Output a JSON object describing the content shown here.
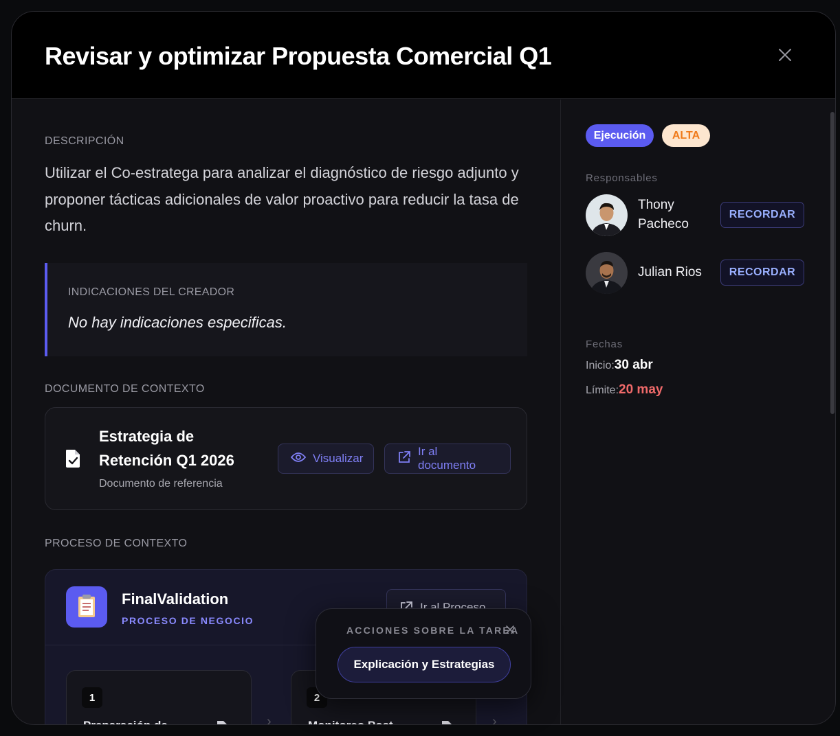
{
  "modal": {
    "title": "Revisar y optimizar Propuesta Comercial Q1"
  },
  "description": {
    "label": "DESCRIPCIÓN",
    "text": "Utilizar el Co-estratega para analizar el diagnóstico de riesgo adjunto y proponer tácticas adicionales de valor proactivo para reducir la tasa de churn."
  },
  "indications": {
    "label": "INDICACIONES DEL CREADOR",
    "text": "No hay indicaciones especificas."
  },
  "document": {
    "label": "DOCUMENTO DE CONTEXTO",
    "title": "Estrategia de Retención Q1 2026",
    "subtitle": "Documento de referencia",
    "view_label": "Visualizar",
    "open_label": "Ir al documento"
  },
  "process": {
    "label": "PROCESO DE CONTEXTO",
    "name": "FinalValidation",
    "kind": "PROCESO DE NEGOCIO",
    "open_label": "Ir al Proceso",
    "steps": [
      {
        "num": "1",
        "title": "Preparación de"
      },
      {
        "num": "2",
        "title": "Monitoreo Post"
      }
    ]
  },
  "popup": {
    "title": "ACCIONES SOBRE LA TAREA",
    "action_label": "Explicación y Estrategias"
  },
  "sidebar": {
    "stage_badge": "Ejecución",
    "priority_badge": "ALTA",
    "responsables_label": "Responsables",
    "people": [
      {
        "name": "Thony Pacheco",
        "remind_label": "RECORDAR"
      },
      {
        "name": "Julian Rios",
        "remind_label": "RECORDAR"
      }
    ],
    "dates_label": "Fechas",
    "start_label": "Inicio:",
    "start_value": "30 abr",
    "due_label": "Límite:",
    "due_value": "20 may"
  },
  "colors": {
    "accent": "#5b5bf0",
    "priority_bg": "#fde6cf",
    "priority_text": "#f07a1a",
    "due_text": "#f06a6a"
  }
}
